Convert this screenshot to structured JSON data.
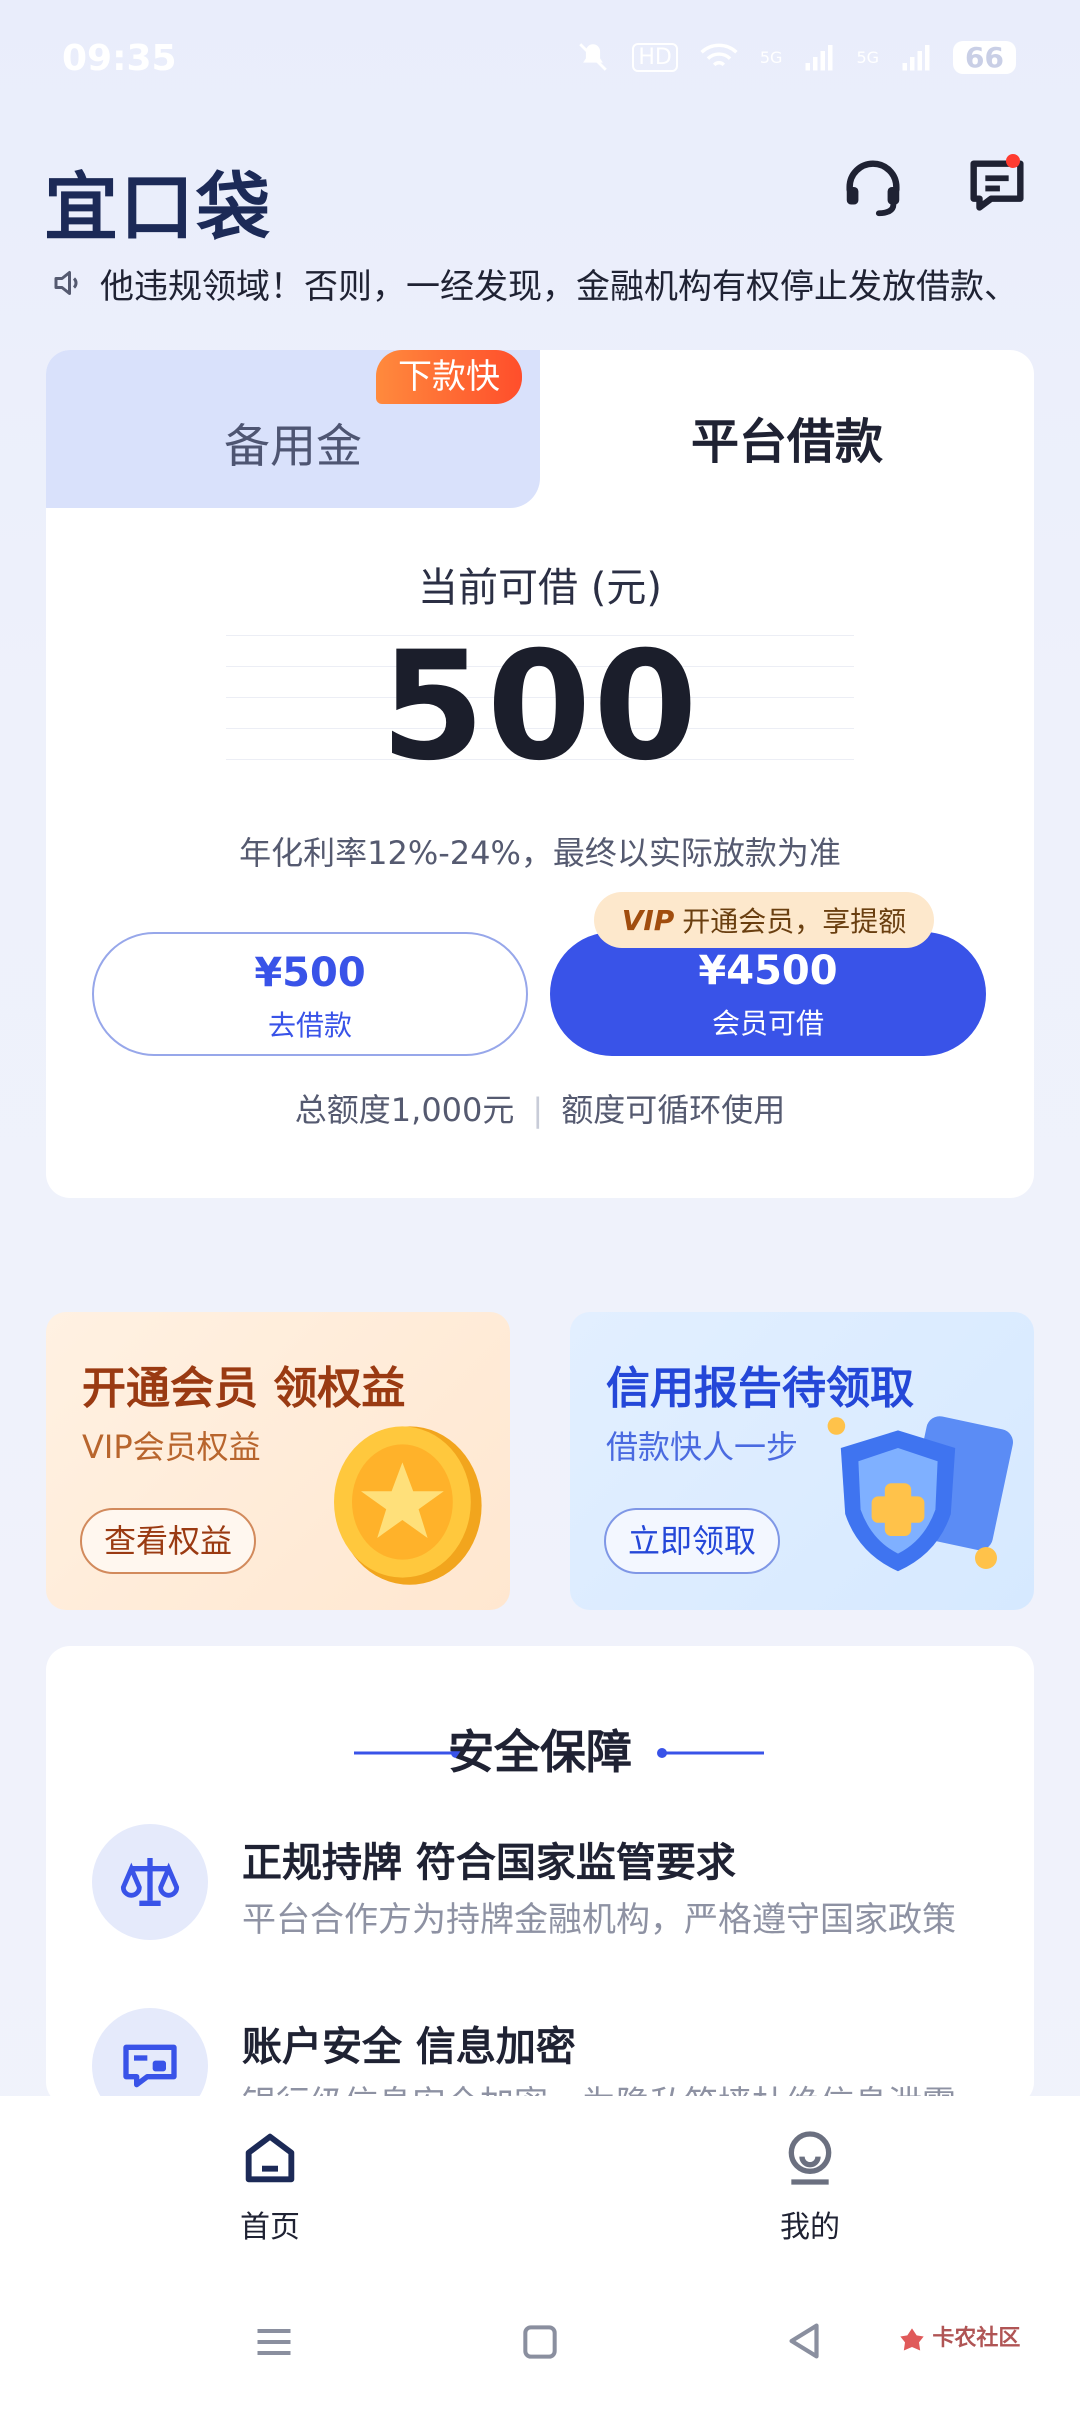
{
  "status_bar": {
    "time": "09:35",
    "hd_label": "HD",
    "signal_label_1": "5G",
    "signal_label_2": "5G",
    "battery": "66"
  },
  "header": {
    "logo_text": "宜口袋",
    "icons": [
      "headset-icon",
      "message-icon"
    ]
  },
  "notice": {
    "text": "他违规领域！否则，一经发现，金融机构有权停止发放借款、"
  },
  "loan_card": {
    "tab_reserve": "备用金",
    "tab_reserve_badge": "下款快",
    "tab_platform": "平台借款",
    "available_label": "当前可借 (元)",
    "amount": "500",
    "rate_text": "年化利率12%-24%，最终以实际放款为准",
    "borrow_button": {
      "amount": "¥500",
      "label": "去借款"
    },
    "member_button": {
      "amount": "¥4500",
      "label": "会员可借"
    },
    "vip_tag": {
      "vip": "VIP",
      "text": "开通会员，享提额"
    },
    "total_limit": "总额度1,000元",
    "separator": "|",
    "cycle_text": "额度可循环使用"
  },
  "promos": {
    "member": {
      "title": "开通会员 领权益",
      "subtitle": "VIP会员权益",
      "button": "查看权益"
    },
    "credit": {
      "title": "信用报告待领取",
      "subtitle": "借款快人一步",
      "button": "立即领取"
    }
  },
  "security": {
    "title": "安全保障",
    "items": [
      {
        "title": "正规持牌 符合国家监管要求",
        "desc": "平台合作方为持牌金融机构，严格遵守国家政策"
      },
      {
        "title": "账户安全 信息加密",
        "desc": "银行级信息安全加密，为隐私筑墙杜绝信息泄露"
      }
    ]
  },
  "bottom_nav": {
    "home": "首页",
    "mine": "我的"
  },
  "watermark": "卡农社区",
  "colors": {
    "primary": "#3953e8",
    "badge_orange": "#ff5a2d",
    "vip_bg": "#fde8cc"
  }
}
